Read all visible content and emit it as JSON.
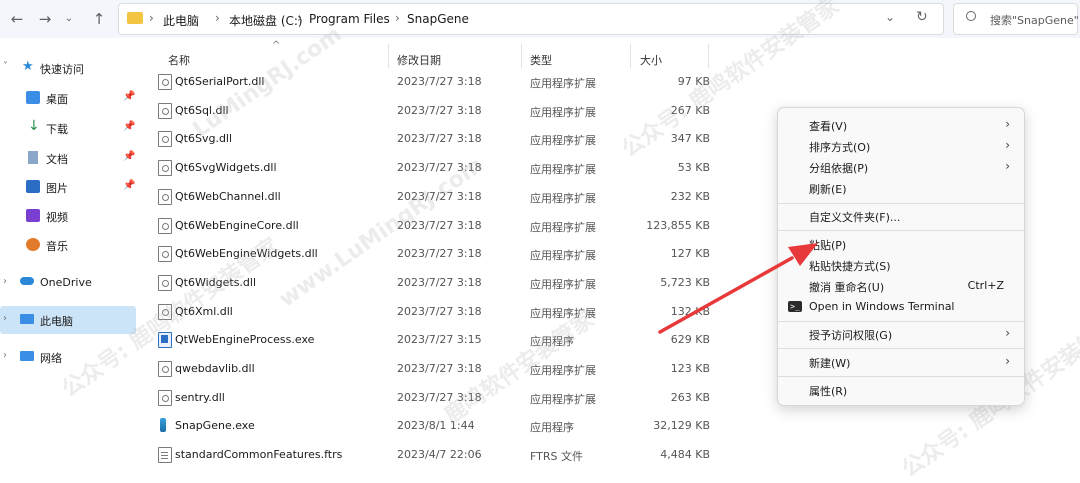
{
  "address": {
    "crumbs": [
      "此电脑",
      "本地磁盘 (C:)",
      "Program Files",
      "SnapGene"
    ],
    "search_placeholder": "搜索\"SnapGene\""
  },
  "nav": {
    "quick_access": "快速访问",
    "items": [
      {
        "label": "桌面",
        "icon": "desktop-icon",
        "pinned": true
      },
      {
        "label": "下载",
        "icon": "download-icon",
        "pinned": true
      },
      {
        "label": "文档",
        "icon": "document-icon",
        "pinned": true
      },
      {
        "label": "图片",
        "icon": "pictures-icon",
        "pinned": true
      },
      {
        "label": "视频",
        "icon": "video-icon",
        "pinned": false
      },
      {
        "label": "音乐",
        "icon": "music-icon",
        "pinned": false
      }
    ],
    "onedrive": "OneDrive",
    "this_pc": "此电脑",
    "network": "网络"
  },
  "columns": {
    "name": "名称",
    "date": "修改日期",
    "type": "类型",
    "size": "大小"
  },
  "files": [
    {
      "name": "Qt6SerialPort.dll",
      "date": "2023/7/27 3:18",
      "type": "应用程序扩展",
      "size": "97 KB",
      "kind": "dll"
    },
    {
      "name": "Qt6Sql.dll",
      "date": "2023/7/27 3:18",
      "type": "应用程序扩展",
      "size": "267 KB",
      "kind": "dll"
    },
    {
      "name": "Qt6Svg.dll",
      "date": "2023/7/27 3:18",
      "type": "应用程序扩展",
      "size": "347 KB",
      "kind": "dll"
    },
    {
      "name": "Qt6SvgWidgets.dll",
      "date": "2023/7/27 3:18",
      "type": "应用程序扩展",
      "size": "53 KB",
      "kind": "dll"
    },
    {
      "name": "Qt6WebChannel.dll",
      "date": "2023/7/27 3:18",
      "type": "应用程序扩展",
      "size": "232 KB",
      "kind": "dll"
    },
    {
      "name": "Qt6WebEngineCore.dll",
      "date": "2023/7/27 3:18",
      "type": "应用程序扩展",
      "size": "123,855 KB",
      "kind": "dll"
    },
    {
      "name": "Qt6WebEngineWidgets.dll",
      "date": "2023/7/27 3:18",
      "type": "应用程序扩展",
      "size": "127 KB",
      "kind": "dll"
    },
    {
      "name": "Qt6Widgets.dll",
      "date": "2023/7/27 3:18",
      "type": "应用程序扩展",
      "size": "5,723 KB",
      "kind": "dll"
    },
    {
      "name": "Qt6Xml.dll",
      "date": "2023/7/27 3:18",
      "type": "应用程序扩展",
      "size": "132 KB",
      "kind": "dll"
    },
    {
      "name": "QtWebEngineProcess.exe",
      "date": "2023/7/27 3:15",
      "type": "应用程序",
      "size": "629 KB",
      "kind": "exe"
    },
    {
      "name": "qwebdavlib.dll",
      "date": "2023/7/27 3:18",
      "type": "应用程序扩展",
      "size": "123 KB",
      "kind": "dll"
    },
    {
      "name": "sentry.dll",
      "date": "2023/7/27 3:18",
      "type": "应用程序扩展",
      "size": "263 KB",
      "kind": "dll"
    },
    {
      "name": "SnapGene.exe",
      "date": "2023/8/1 1:44",
      "type": "应用程序",
      "size": "32,129 KB",
      "kind": "snap"
    },
    {
      "name": "standardCommonFeatures.ftrs",
      "date": "2023/4/7 22:06",
      "type": "FTRS 文件",
      "size": "4,484 KB",
      "kind": "txt"
    }
  ],
  "context_menu": {
    "view": "查看(V)",
    "sort": "排序方式(O)",
    "group": "分组依据(P)",
    "refresh": "刷新(E)",
    "customize": "自定义文件夹(F)...",
    "paste": "粘贴(P)",
    "paste_shortcut": "粘贴快捷方式(S)",
    "undo": "撤消 重命名(U)",
    "undo_shortcut": "Ctrl+Z",
    "terminal": "Open in Windows Terminal",
    "give_access": "授予访问权限(G)",
    "new": "新建(W)",
    "properties": "属性(R)"
  },
  "watermarks": [
    "公众号: 鹿鸣软件安装管家",
    "LuMingRJ.com",
    "鹿鸣软件安装管家",
    "www.LuMingRJ.com"
  ],
  "colors": {
    "arrow": "#e8393a",
    "selected": "#cce4f7"
  }
}
